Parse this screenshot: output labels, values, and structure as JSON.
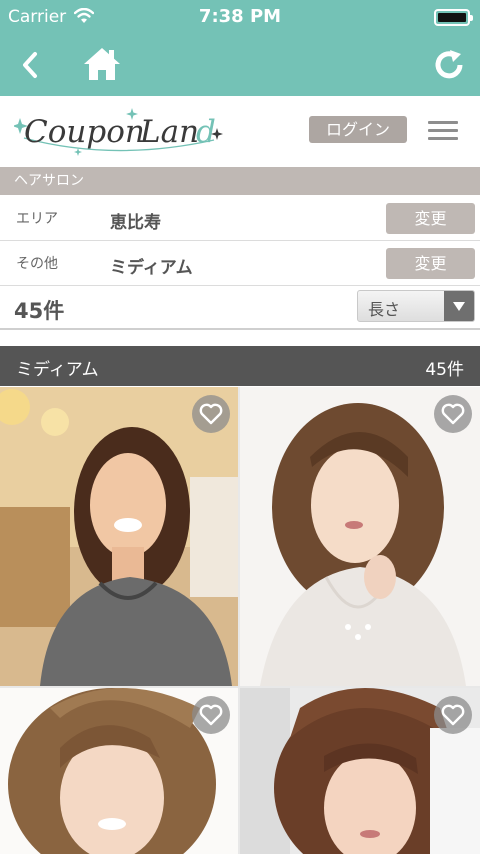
{
  "status_bar": {
    "carrier": "Carrier",
    "time": "7:38 PM",
    "battery_level": 1.0
  },
  "nav": {
    "icons": [
      "back-chevron-icon",
      "home-icon",
      "reload-icon"
    ]
  },
  "header": {
    "logo_text": "CouponLand",
    "login_label": "ログイン",
    "menu_icon": "hamburger-icon"
  },
  "section": {
    "title": "ヘアサロン"
  },
  "filters": [
    {
      "label": "エリア",
      "value": "恵比寿",
      "change_label": "変更"
    },
    {
      "label": "その他",
      "value": "ミディアム",
      "change_label": "変更"
    }
  ],
  "results": {
    "count": "45件",
    "sort_value": "長さ"
  },
  "list": {
    "title": "ミディアム",
    "count": "45件",
    "items": [
      {
        "fav_icon": "heart-icon"
      },
      {
        "fav_icon": "heart-icon"
      },
      {
        "fav_icon": "heart-icon"
      },
      {
        "fav_icon": "heart-icon"
      }
    ]
  },
  "colors": {
    "brand": "#74c2b6",
    "button_gray": "#bfb8b4",
    "list_header": "#555555"
  }
}
